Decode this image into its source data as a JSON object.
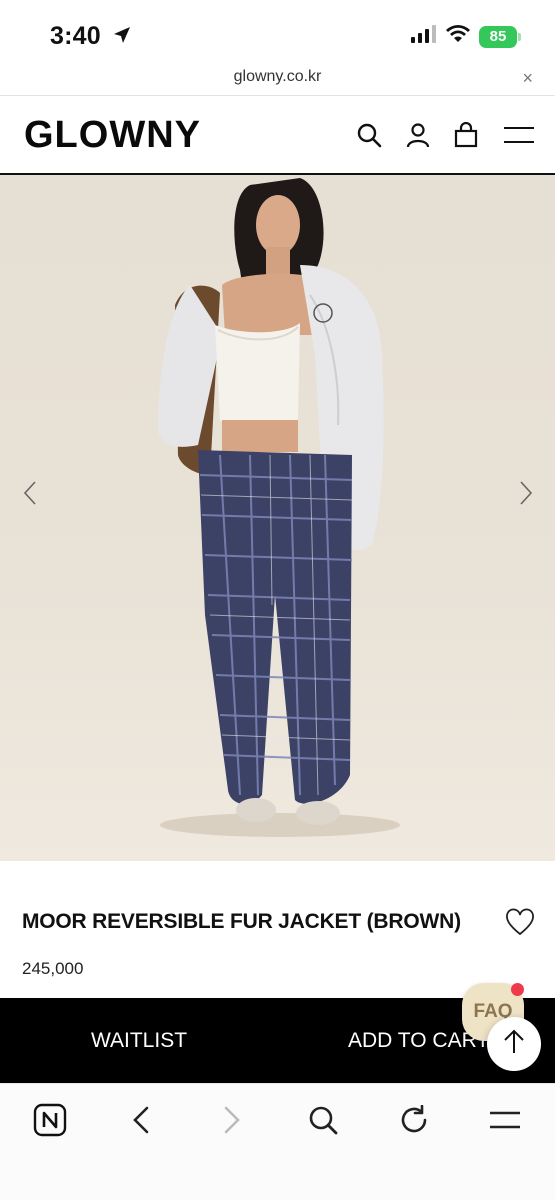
{
  "status_bar": {
    "time": "3:40",
    "battery": "85"
  },
  "url_bar": {
    "domain": "glowny.co.kr",
    "close": "×"
  },
  "header": {
    "logo": "GLOWNY"
  },
  "product": {
    "title": "MOOR REVERSIBLE FUR JACKET (BROWN)",
    "price": "245,000"
  },
  "actions": {
    "waitlist": "WAITLIST",
    "add_to_cart": "ADD TO CART",
    "faq": "FAQ"
  },
  "icons": {
    "header": [
      "search-icon",
      "user-icon",
      "bag-icon",
      "menu-icon"
    ],
    "browser_toolbar": [
      "naver-icon",
      "back-icon",
      "forward-icon",
      "search-icon",
      "reload-icon",
      "menu-icon"
    ]
  },
  "colors": {
    "battery": "#34c759",
    "faq_bg": "#efe3c6",
    "notification_dot": "#ee3b4b",
    "action_bar": "#000000"
  }
}
